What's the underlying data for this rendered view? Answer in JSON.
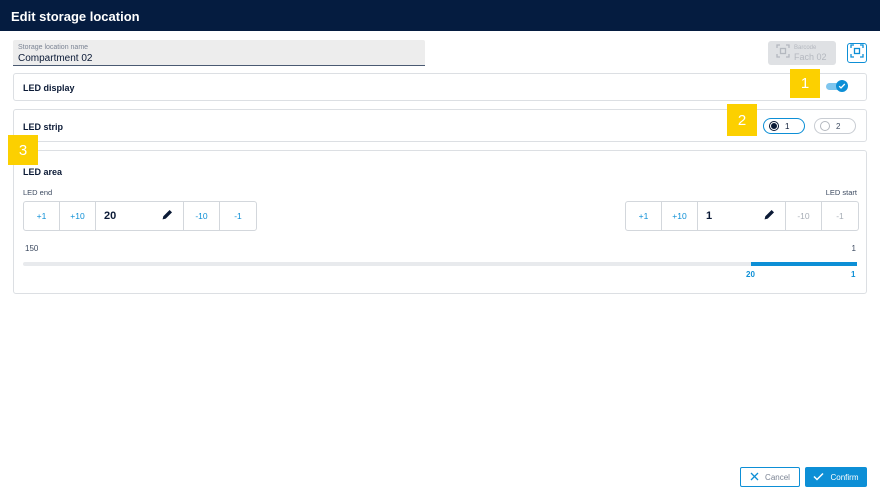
{
  "window": {
    "title": "Edit storage location"
  },
  "name_field": {
    "label": "Storage location name",
    "value": "Compartment 02"
  },
  "barcode": {
    "label": "Barcode",
    "value": "Fach 02"
  },
  "led_display": {
    "title": "LED display",
    "enabled": true
  },
  "led_strip": {
    "title": "LED strip",
    "options": [
      "1",
      "2"
    ],
    "selected": "1"
  },
  "led_area": {
    "title": "LED area",
    "end": {
      "label": "LED end",
      "inc1": "+1",
      "inc10": "+10",
      "value": "20",
      "dec10": "-10",
      "dec1": "-1"
    },
    "start": {
      "label": "LED start",
      "inc1": "+1",
      "inc10": "+10",
      "value": "1",
      "dec10": "-10",
      "dec1": "-1"
    },
    "range": {
      "min_label": "150",
      "max_label": "1",
      "selected_end": "20",
      "selected_start": "1"
    }
  },
  "markers": [
    "1",
    "2",
    "3"
  ],
  "footer": {
    "cancel_label": "Cancel",
    "confirm_label": "Confirm"
  },
  "colors": {
    "titlebar": "#051c40",
    "accent": "#0d8fd6",
    "marker": "#fcd000"
  }
}
